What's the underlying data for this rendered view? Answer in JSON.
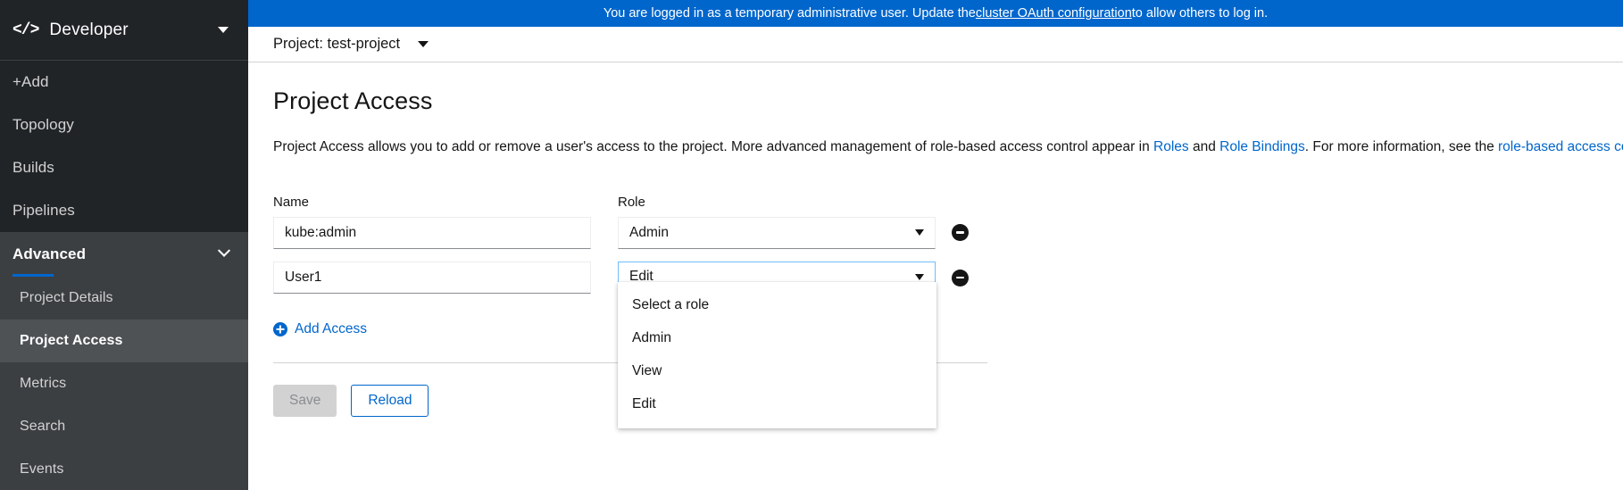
{
  "sidebar": {
    "perspective": {
      "label": "Developer",
      "icon": "code-icon",
      "caret": "chevron-down-icon"
    },
    "items": [
      {
        "label": "+Add"
      },
      {
        "label": "Topology"
      },
      {
        "label": "Builds"
      },
      {
        "label": "Pipelines"
      }
    ],
    "section": {
      "label": "Advanced",
      "expanded": true
    },
    "subitems": [
      {
        "label": "Project Details",
        "active": false
      },
      {
        "label": "Project Access",
        "active": true
      },
      {
        "label": "Metrics",
        "active": false
      },
      {
        "label": "Search",
        "active": false
      },
      {
        "label": "Events",
        "active": false
      }
    ]
  },
  "banner": {
    "text_before": "You are logged in as a temporary administrative user. Update the ",
    "link": "cluster OAuth configuration",
    "text_after": " to allow others to log in.",
    "background": "#0066cc"
  },
  "project_bar": {
    "label": "Project: test-project"
  },
  "page": {
    "title": "Project Access",
    "description": {
      "part1": "Project Access allows you to add or remove a user's access to the project. More advanced management of role-based access control appear in ",
      "link_roles": "Roles",
      "part2": " and ",
      "link_role_bindings": "Role Bindings",
      "part3": ". For more information, see the ",
      "link_docs": "role-based access control documentation",
      "part4": " ."
    }
  },
  "form": {
    "headers": {
      "name": "Name",
      "role": "Role"
    },
    "rows": [
      {
        "name": "kube:admin",
        "role": "Admin",
        "focused": false,
        "remove": "remove-icon"
      },
      {
        "name": "User1",
        "role": "Edit",
        "focused": true,
        "remove": "remove-icon"
      }
    ],
    "add_access_label": "Add Access",
    "buttons": {
      "save": "Save",
      "reload": "Reload"
    }
  },
  "dropdown": {
    "open": true,
    "options": [
      "Select a role",
      "Admin",
      "View",
      "Edit"
    ]
  },
  "colors": {
    "accent": "#0066cc",
    "sidebar_bg": "#212427",
    "sidebar_section_bg": "#3c3f42",
    "sidebar_active_bg": "#4f5255",
    "link": "#0066cc"
  }
}
